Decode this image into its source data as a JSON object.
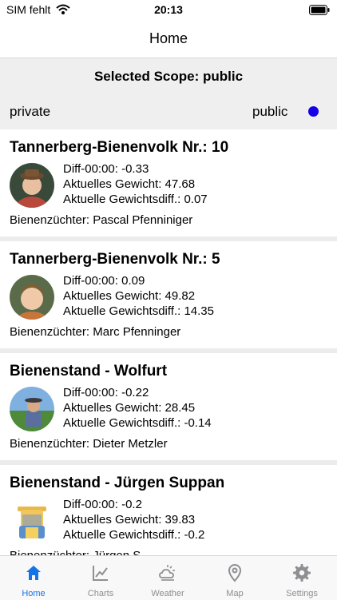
{
  "status": {
    "carrier": "SIM fehlt",
    "time": "20:13"
  },
  "nav": {
    "title": "Home"
  },
  "scope": {
    "title": "Selected Scope: public",
    "private_label": "private",
    "public_label": "public",
    "selected": "public"
  },
  "colors": {
    "accent": "#1474e6",
    "scope_dot": "#1400e6",
    "inactive_tab": "#8e8e93"
  },
  "hives": [
    {
      "title": "Tannerberg-Bienenvolk Nr.: 10",
      "diff": "Diff-00:00: -0.33",
      "weight": "Aktuelles Gewicht: 47.68",
      "weight_diff": "Aktuelle Gewichtsdiff.: 0.07",
      "breeder": "Bienenzüchter: Pascal Pfenniniger"
    },
    {
      "title": "Tannerberg-Bienenvolk Nr.: 5",
      "diff": "Diff-00:00: 0.09",
      "weight": "Aktuelles Gewicht: 49.82",
      "weight_diff": "Aktuelle Gewichtsdiff.: 14.35",
      "breeder": "Bienenzüchter: Marc Pfenninger"
    },
    {
      "title": "Bienenstand - Wolfurt",
      "diff": "Diff-00:00: -0.22",
      "weight": "Aktuelles Gewicht: 28.45",
      "weight_diff": "Aktuelle Gewichtsdiff.: -0.14",
      "breeder": "Bienenzüchter: Dieter Metzler"
    },
    {
      "title": "Bienenstand - Jürgen Suppan",
      "diff": "Diff-00:00: -0.2",
      "weight": "Aktuelles Gewicht: 39.83",
      "weight_diff": "Aktuelle Gewichtsdiff.: -0.2",
      "breeder": "Bienenzüchter: Jürgen S..."
    }
  ],
  "tabs": [
    {
      "label": "Home",
      "icon": "home-icon",
      "active": true
    },
    {
      "label": "Charts",
      "icon": "chart-icon",
      "active": false
    },
    {
      "label": "Weather",
      "icon": "weather-icon",
      "active": false
    },
    {
      "label": "Map",
      "icon": "map-pin-icon",
      "active": false
    },
    {
      "label": "Settings",
      "icon": "gear-icon",
      "active": false
    }
  ]
}
